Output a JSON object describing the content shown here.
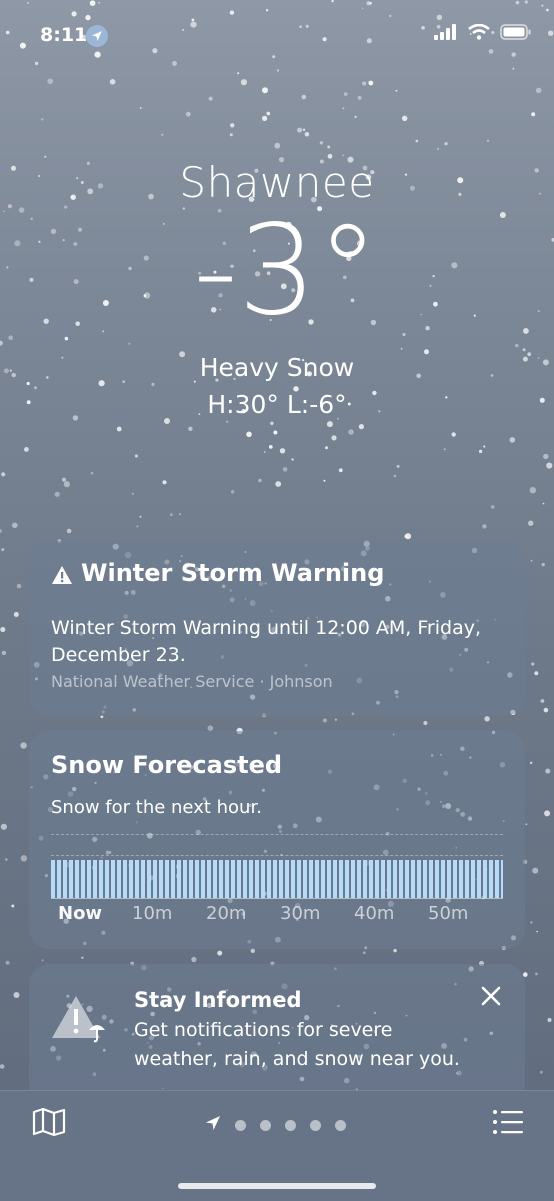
{
  "status_bar": {
    "time": "8:11"
  },
  "location": {
    "city": "Shawnee",
    "temperature": "-3°",
    "condition": "Heavy Snow",
    "high_low": "H:30°  L:-6°"
  },
  "alert_card": {
    "title": "Winter Storm Warning",
    "body": "Winter Storm Warning until 12:00 AM, Friday, December 23.",
    "source": "National Weather Service · Johnson"
  },
  "precip_card": {
    "title": "Snow Forecasted",
    "subtitle": "Snow for the next hour.",
    "bar_color": "#b9e0ff",
    "ticks": [
      "Now",
      "10m",
      "20m",
      "30m",
      "40m",
      "50m"
    ]
  },
  "info_card": {
    "title": "Stay Informed",
    "body": "Get notifications for severe weather, rain, and snow near you."
  },
  "tab_bar": {
    "page_dots": 5,
    "icons": [
      "map-icon",
      "location-arrow-icon",
      "list-icon"
    ]
  }
}
